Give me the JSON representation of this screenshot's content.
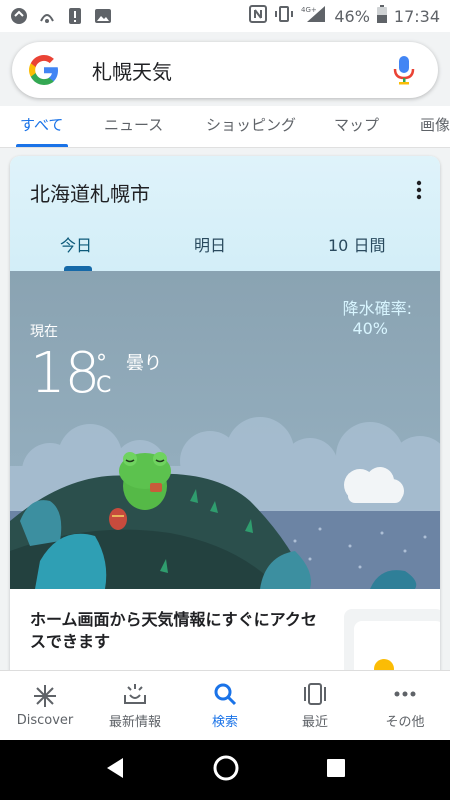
{
  "status_bar": {
    "battery": "46%",
    "time": "17:34",
    "network": "4G+",
    "icons_left": [
      "tethering-icon",
      "wifi-calling-icon",
      "alert-icon",
      "image-icon"
    ],
    "icons_right": [
      "nfc-icon",
      "vibrate-icon",
      "signal-icon",
      "battery-icon"
    ]
  },
  "search": {
    "query": "札幌天気",
    "logo": "google-g-logo",
    "mic_icon": "mic-icon"
  },
  "tabs": [
    {
      "label": "すべて",
      "active": true
    },
    {
      "label": "ニュース",
      "active": false
    },
    {
      "label": "ショッピング",
      "active": false
    },
    {
      "label": "マップ",
      "active": false
    },
    {
      "label": "画像",
      "active": false
    }
  ],
  "weather": {
    "location": "北海道札幌市",
    "tabs": [
      "今日",
      "明日",
      "10 日間"
    ],
    "now_label": "現在",
    "temperature": "18",
    "degree": "°",
    "unit": "C",
    "condition": "曇り",
    "precip_label": "降水確率:",
    "precip_value": "40%",
    "condition_icon": "cloud-icon"
  },
  "promo": {
    "text": "ホーム画面から天気情報にすぐにアクセスできます"
  },
  "bottom_nav": [
    {
      "label": "Discover",
      "icon": "asterisk-icon",
      "active": false
    },
    {
      "label": "最新情報",
      "icon": "updates-icon",
      "active": false
    },
    {
      "label": "検索",
      "icon": "search-icon",
      "active": true
    },
    {
      "label": "最近",
      "icon": "recent-icon",
      "active": false
    },
    {
      "label": "その他",
      "icon": "more-dots-icon",
      "active": false
    }
  ],
  "colors": {
    "accent": "#1a73e8",
    "sky_header": "#dff3fa",
    "scene_bg": "#8aa3b2",
    "precip_text": "#d8f5ff"
  }
}
